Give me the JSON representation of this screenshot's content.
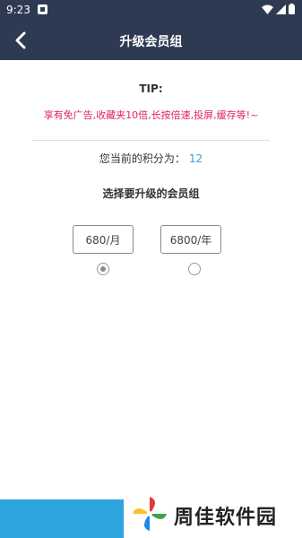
{
  "status_bar": {
    "time": "9:23"
  },
  "app_bar": {
    "title": "升级会员组"
  },
  "tip": {
    "title": "TIP:",
    "text": "享有免广告,收藏夹10倍,长按倍速,投屏,缓存等!~"
  },
  "points": {
    "label": "您当前的积分为：",
    "value": "12"
  },
  "choose_label": "选择要升级的会员组",
  "options": [
    {
      "label": "680/月",
      "selected": true
    },
    {
      "label": "6800/年",
      "selected": false
    }
  ],
  "watermark": {
    "text": "周佳软件园"
  },
  "colors": {
    "header": "#2e3a52",
    "tip_red": "#e0245e",
    "points_blue": "#3a9bd5",
    "bottom_blue": "#2ea4dc"
  }
}
